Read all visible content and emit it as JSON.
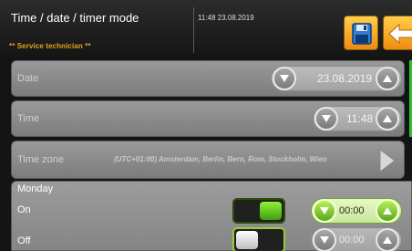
{
  "header": {
    "title": "Time / date / timer mode",
    "subtitle": "** Service technician **",
    "datetime": "11:48 23.08.2019",
    "save_icon": "floppy-disk-icon",
    "back_icon": "back-arrow-icon",
    "accent_color": "#f5a623"
  },
  "rows": {
    "date": {
      "label": "Date",
      "value": "23.08.2019"
    },
    "time": {
      "label": "Time",
      "value": "11:48"
    },
    "timezone": {
      "label": "Time zone",
      "value": "(UTC+01:00) Amsterdam, Berlin, Bern, Rom, Stockholm, Wien"
    }
  },
  "day": {
    "name": "Monday",
    "on": {
      "label": "On",
      "enabled": true,
      "time": "00:00"
    },
    "off": {
      "label": "Off",
      "enabled": false,
      "time": "00:00"
    }
  },
  "colors": {
    "active_green": "#5aa81a",
    "status_strip": "#2fbf2f"
  }
}
